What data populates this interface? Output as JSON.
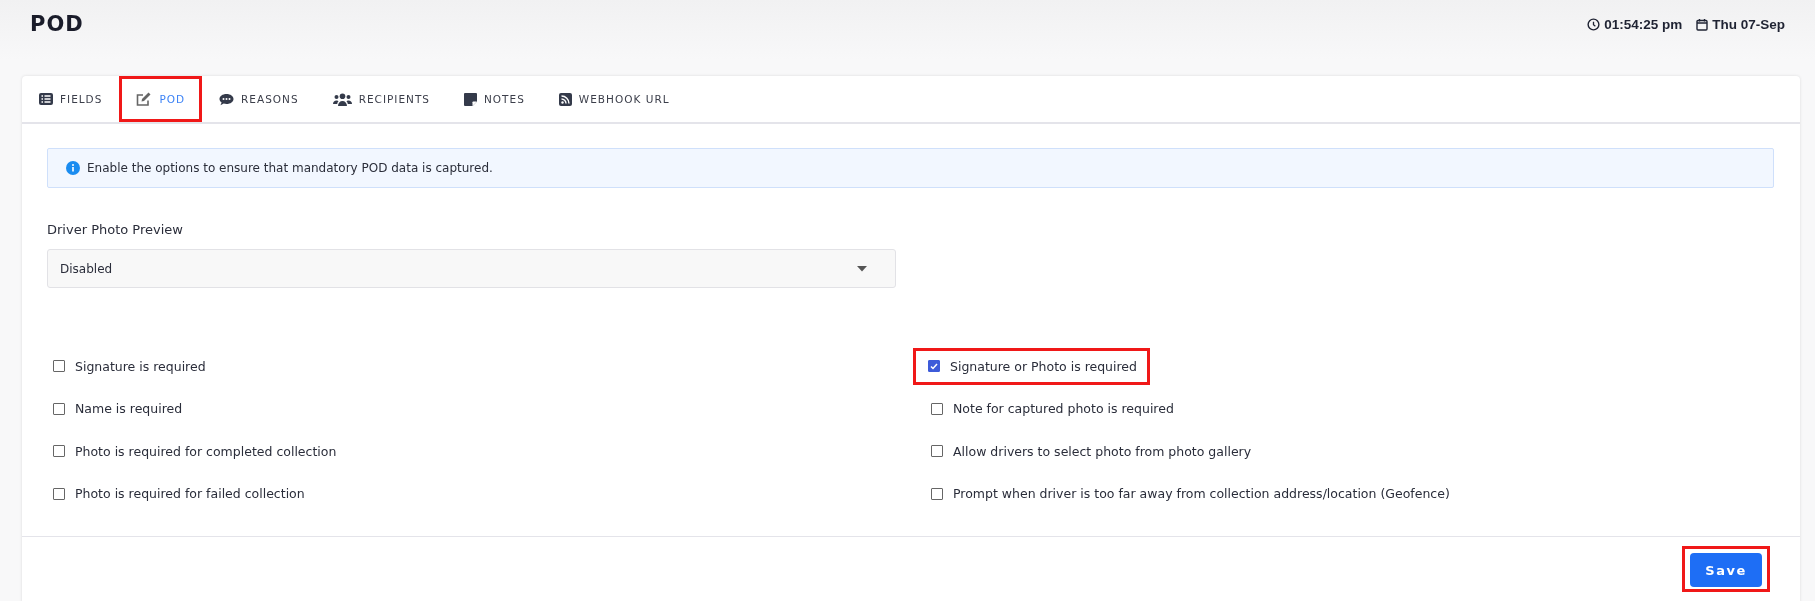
{
  "page": {
    "title": "POD",
    "time": "01:54:25 pm",
    "date": "Thu 07-Sep"
  },
  "tabs": [
    {
      "label": "FIELDS",
      "kind": "list",
      "selected": false,
      "highlighted": false
    },
    {
      "label": "POD",
      "kind": "edit",
      "selected": true,
      "highlighted": true
    },
    {
      "label": "REASONS",
      "kind": "comment",
      "selected": false,
      "highlighted": false
    },
    {
      "label": "RECIPIENTS",
      "kind": "users",
      "selected": false,
      "highlighted": false
    },
    {
      "label": "NOTES",
      "kind": "note",
      "selected": false,
      "highlighted": false
    },
    {
      "label": "WEBHOOK URL",
      "kind": "rss",
      "selected": false,
      "highlighted": false
    }
  ],
  "info": "Enable the options to ensure that mandatory POD data is captured.",
  "driver_photo_preview": {
    "label": "Driver Photo Preview",
    "value": "Disabled"
  },
  "options_left": [
    {
      "label": "Signature is required",
      "checked": false,
      "highlighted": false
    },
    {
      "label": "Name is required",
      "checked": false,
      "highlighted": false
    },
    {
      "label": "Photo is required for completed collection",
      "checked": false,
      "highlighted": false
    },
    {
      "label": "Photo is required for failed collection",
      "checked": false,
      "highlighted": false
    }
  ],
  "options_right": [
    {
      "label": "Signature or Photo is required",
      "checked": true,
      "highlighted": true
    },
    {
      "label": "Note for captured photo is required",
      "checked": false,
      "highlighted": false
    },
    {
      "label": "Allow drivers to select photo from photo gallery",
      "checked": false,
      "highlighted": false
    },
    {
      "label": "Prompt when driver is too far away from collection address/location (Geofence)",
      "checked": false,
      "highlighted": false
    }
  ],
  "save_button": {
    "label": "Save",
    "highlighted": true
  }
}
